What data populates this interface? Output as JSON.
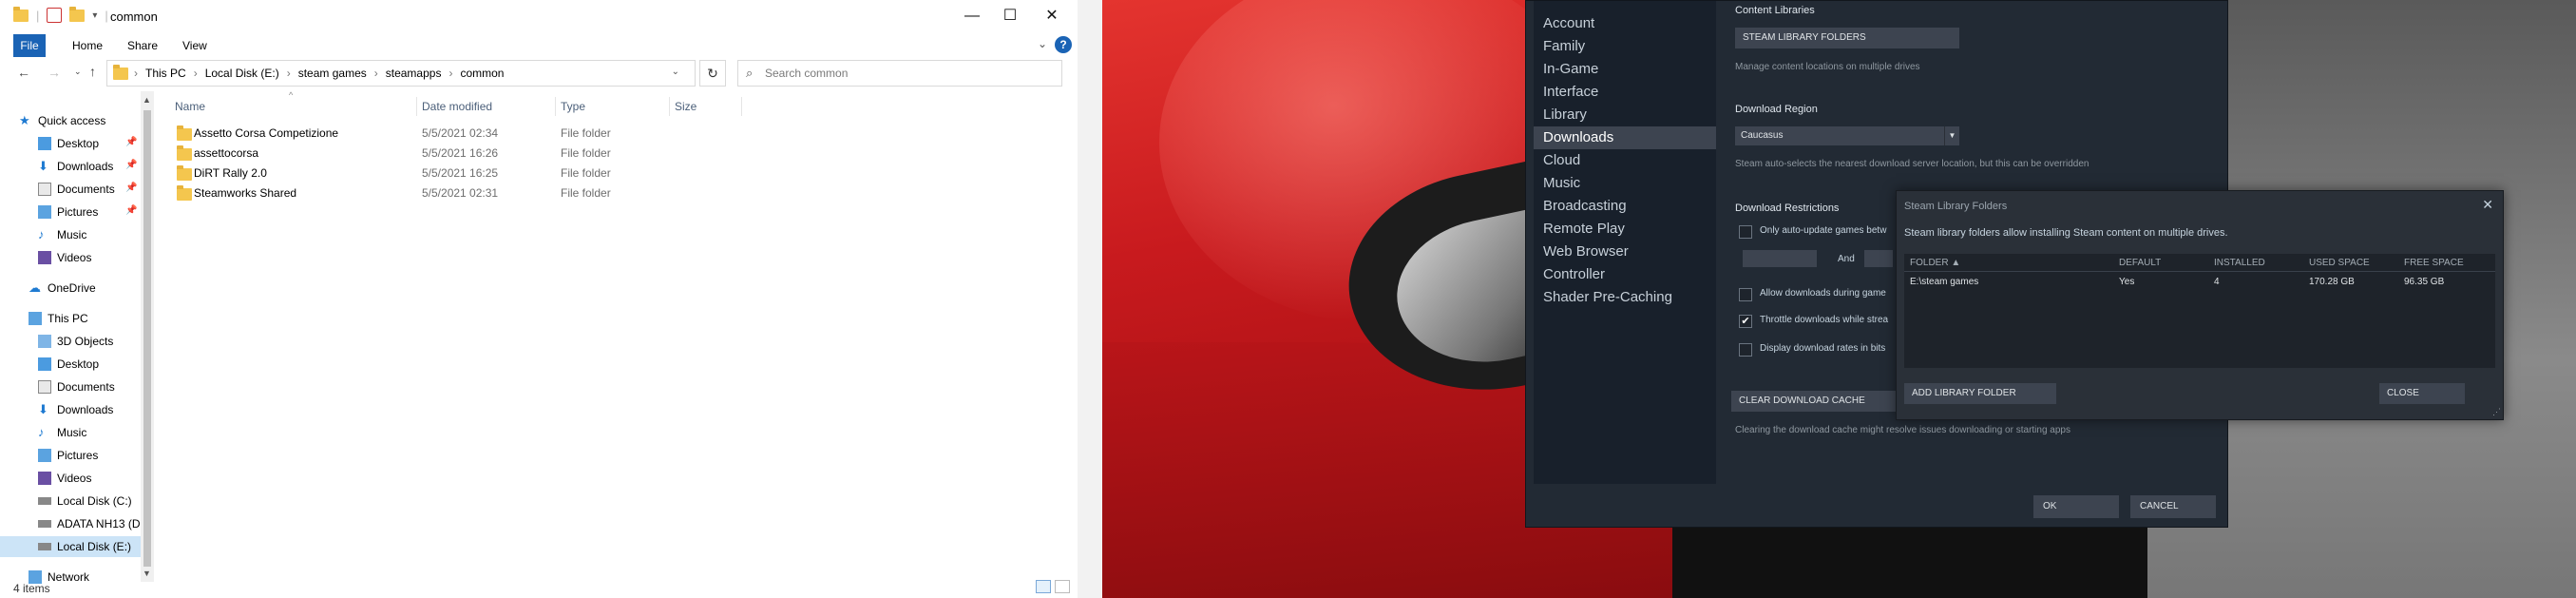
{
  "explorer": {
    "title": "common",
    "window_controls": {
      "minimize": "—",
      "maximize": "☐",
      "close": "✕"
    },
    "ribbon_tabs": [
      "File",
      "Home",
      "Share",
      "View"
    ],
    "help": "?",
    "breadcrumb": [
      "This PC",
      "Local Disk (E:)",
      "steam games",
      "steamapps",
      "common"
    ],
    "search_placeholder": "Search common",
    "nav": {
      "quick_access": "Quick access",
      "quick_items": [
        "Desktop",
        "Downloads",
        "Documents",
        "Pictures",
        "Music",
        "Videos"
      ],
      "onedrive": "OneDrive",
      "this_pc": "This PC",
      "pc_items": [
        "3D Objects",
        "Desktop",
        "Documents",
        "Downloads",
        "Music",
        "Pictures",
        "Videos",
        "Local Disk (C:)",
        "ADATA NH13 (D:",
        "Local Disk (E:)"
      ],
      "network": "Network"
    },
    "columns": {
      "name": "Name",
      "date": "Date modified",
      "type": "Type",
      "size": "Size"
    },
    "files": [
      {
        "name": "Assetto Corsa Competizione",
        "date": "5/5/2021 02:34",
        "type": "File folder"
      },
      {
        "name": "assettocorsa",
        "date": "5/5/2021 16:26",
        "type": "File folder"
      },
      {
        "name": "DiRT Rally 2.0",
        "date": "5/5/2021 16:25",
        "type": "File folder"
      },
      {
        "name": "Steamworks Shared",
        "date": "5/5/2021 02:31",
        "type": "File folder"
      }
    ],
    "status": "4 items"
  },
  "steam_settings": {
    "nav_items": [
      "Account",
      "Family",
      "In-Game",
      "Interface",
      "Library",
      "Downloads",
      "Cloud",
      "Music",
      "Broadcasting",
      "Remote Play",
      "Web Browser",
      "Controller",
      "Shader Pre-Caching"
    ],
    "active_nav": "Downloads",
    "content_libraries_label": "Content Libraries",
    "library_folders_button": "STEAM LIBRARY FOLDERS",
    "library_desc": "Manage content locations on multiple drives",
    "download_region_label": "Download Region",
    "region_value": "Caucasus",
    "region_desc": "Steam auto-selects the nearest download server location, but this can be overridden",
    "restrictions_label": "Download Restrictions",
    "opt_auto_update": "Only auto-update games betw",
    "and_label": "And",
    "opt_allow_during": "Allow downloads during game",
    "opt_throttle": "Throttle downloads while strea",
    "opt_display_rates": "Display download rates in bits",
    "clear_cache_button": "CLEAR DOWNLOAD CACHE",
    "clear_cache_desc": "Clearing the download cache might resolve issues downloading or starting apps",
    "ok": "OK",
    "cancel": "CANCEL"
  },
  "library_dialog": {
    "title": "Steam Library Folders",
    "close": "✕",
    "desc": "Steam library folders allow installing Steam content on multiple drives.",
    "headers": {
      "folder": "FOLDER ▲",
      "default": "DEFAULT",
      "installed": "INSTALLED",
      "used": "USED SPACE",
      "free": "FREE SPACE"
    },
    "rows": [
      {
        "folder": "E:\\steam games",
        "default": "Yes",
        "installed": "4",
        "used": "170.28 GB",
        "free": "96.35 GB"
      }
    ],
    "add_button": "ADD LIBRARY FOLDER",
    "close_button": "CLOSE"
  }
}
